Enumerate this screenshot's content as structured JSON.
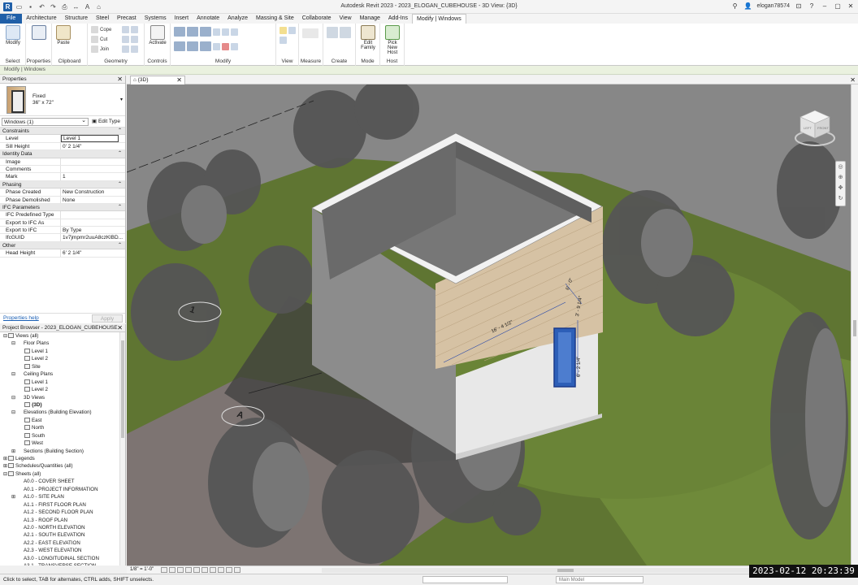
{
  "app": {
    "title": "Autodesk Revit 2023 - 2023_ELOGAN_CUBEHOUSE - 3D View: {3D}",
    "user": "elogan78574"
  },
  "ribbon_tabs": [
    "File",
    "Architecture",
    "Structure",
    "Steel",
    "Precast",
    "Systems",
    "Insert",
    "Annotate",
    "Analyze",
    "Massing & Site",
    "Collaborate",
    "View",
    "Manage",
    "Add-Ins",
    "Modify | Windows"
  ],
  "ribbon": {
    "select": {
      "label": "Select",
      "modify": "Modify"
    },
    "properties": {
      "label": "Properties"
    },
    "clipboard": {
      "label": "Clipboard",
      "paste": "Paste",
      "cope": "Cope",
      "cut": "Cut",
      "join": "Join"
    },
    "geometry": {
      "label": "Geometry"
    },
    "controls": {
      "label": "Controls",
      "activate": "Activate"
    },
    "modify": {
      "label": "Modify"
    },
    "view": {
      "label": "View"
    },
    "measure": {
      "label": "Measure"
    },
    "create": {
      "label": "Create"
    },
    "mode": {
      "label": "Mode",
      "edit_family_1": "Edit",
      "edit_family_2": "Family"
    },
    "host": {
      "label": "Host",
      "pick_1": "Pick",
      "pick_2": "New Host"
    }
  },
  "context_bar": "Modify | Windows",
  "properties": {
    "title": "Properties",
    "type_name": "Fixed",
    "type_size": "36\" x 72\"",
    "instance_selector": "Windows (1)",
    "edit_type": "Edit Type",
    "categories": [
      {
        "name": "Constraints",
        "rows": [
          {
            "k": "Level",
            "v": "Level 1"
          },
          {
            "k": "Sill Height",
            "v": "0'  2 1/4\""
          }
        ]
      },
      {
        "name": "Identity Data",
        "rows": [
          {
            "k": "Image",
            "v": ""
          },
          {
            "k": "Comments",
            "v": ""
          },
          {
            "k": "Mark",
            "v": "1"
          }
        ]
      },
      {
        "name": "Phasing",
        "rows": [
          {
            "k": "Phase Created",
            "v": "New Construction"
          },
          {
            "k": "Phase Demolished",
            "v": "None"
          }
        ]
      },
      {
        "name": "IFC Parameters",
        "rows": [
          {
            "k": "IFC Predefined Type",
            "v": ""
          },
          {
            "k": "Export to IFC As",
            "v": ""
          },
          {
            "k": "Export to IFC",
            "v": "By Type"
          },
          {
            "k": "IfcGUID",
            "v": "1v7jmpmr2uuA8czKlBD..."
          }
        ]
      },
      {
        "name": "Other",
        "rows": [
          {
            "k": "Head Height",
            "v": "6'  2 1/4\""
          }
        ]
      }
    ],
    "help": "Properties help",
    "apply": "Apply"
  },
  "browser": {
    "title": "Project Browser - 2023_ELOGAN_CUBEHOUSE",
    "nodes": [
      {
        "d": 0,
        "t": "−",
        "label": "Views (all)",
        "icon": "views"
      },
      {
        "d": 1,
        "t": "−",
        "label": "Floor Plans",
        "icon": "none"
      },
      {
        "d": 2,
        "t": "",
        "label": "Level 1",
        "icon": "view"
      },
      {
        "d": 2,
        "t": "",
        "label": "Level 2",
        "icon": "view"
      },
      {
        "d": 2,
        "t": "",
        "label": "Site",
        "icon": "view"
      },
      {
        "d": 1,
        "t": "−",
        "label": "Ceiling Plans",
        "icon": "none"
      },
      {
        "d": 2,
        "t": "",
        "label": "Level 1",
        "icon": "view"
      },
      {
        "d": 2,
        "t": "",
        "label": "Level 2",
        "icon": "view"
      },
      {
        "d": 1,
        "t": "−",
        "label": "3D Views",
        "icon": "none"
      },
      {
        "d": 2,
        "t": "",
        "label": "{3D}",
        "icon": "view",
        "bold": true
      },
      {
        "d": 1,
        "t": "−",
        "label": "Elevations (Building Elevation)",
        "icon": "none"
      },
      {
        "d": 2,
        "t": "",
        "label": "East",
        "icon": "view"
      },
      {
        "d": 2,
        "t": "",
        "label": "North",
        "icon": "view"
      },
      {
        "d": 2,
        "t": "",
        "label": "South",
        "icon": "view"
      },
      {
        "d": 2,
        "t": "",
        "label": "West",
        "icon": "view"
      },
      {
        "d": 1,
        "t": "+",
        "label": "Sections (Building Section)",
        "icon": "none"
      },
      {
        "d": 0,
        "t": "+",
        "label": "Legends",
        "icon": "view"
      },
      {
        "d": 0,
        "t": "+",
        "label": "Schedules/Quantities (all)",
        "icon": "view"
      },
      {
        "d": 0,
        "t": "−",
        "label": "Sheets (all)",
        "icon": "view"
      },
      {
        "d": 1,
        "t": "",
        "label": "A0.0 - COVER SHEET",
        "icon": "none"
      },
      {
        "d": 1,
        "t": "",
        "label": "A0.1 - PROJECT INFORMATION",
        "icon": "none"
      },
      {
        "d": 1,
        "t": "+",
        "label": "A1.0 - SITE PLAN",
        "icon": "none"
      },
      {
        "d": 1,
        "t": "",
        "label": "A1.1 - FIRST FLOOR PLAN",
        "icon": "none"
      },
      {
        "d": 1,
        "t": "",
        "label": "A1.2 - SECOND FLOOR PLAN",
        "icon": "none"
      },
      {
        "d": 1,
        "t": "",
        "label": "A1.3 - ROOF PLAN",
        "icon": "none"
      },
      {
        "d": 1,
        "t": "",
        "label": "A2.0 - NORTH ELEVATION",
        "icon": "none"
      },
      {
        "d": 1,
        "t": "",
        "label": "A2.1 - SOUTH ELEVATION",
        "icon": "none"
      },
      {
        "d": 1,
        "t": "",
        "label": "A2.2 - EAST ELEVATION",
        "icon": "none"
      },
      {
        "d": 1,
        "t": "",
        "label": "A2.3 - WEST ELEVATION",
        "icon": "none"
      },
      {
        "d": 1,
        "t": "",
        "label": "A3.0 - LONGITUDINAL SECTION",
        "icon": "none"
      },
      {
        "d": 1,
        "t": "",
        "label": "A3.1 - TRANSVERSE SECTION",
        "icon": "none"
      }
    ]
  },
  "view_tab": "{3D}",
  "viewport": {
    "grid_1": "1",
    "grid_a": "A",
    "dim_top": "16' - 4 1/2\"",
    "dim_side_1": "6' - 0\"",
    "dim_side_2": "3' - 9 1/4\"",
    "dim_window": "6' - 2 1/4\"",
    "viewcube_left": "LEFT",
    "viewcube_front": "FRONT"
  },
  "view_control": {
    "scale": "1/8\" = 1'-0\""
  },
  "status": {
    "message": "Click to select, TAB for alternates, CTRL adds, SHIFT unselects.",
    "model": "Main Model"
  },
  "timestamp": "2023-02-12  20:23:39"
}
